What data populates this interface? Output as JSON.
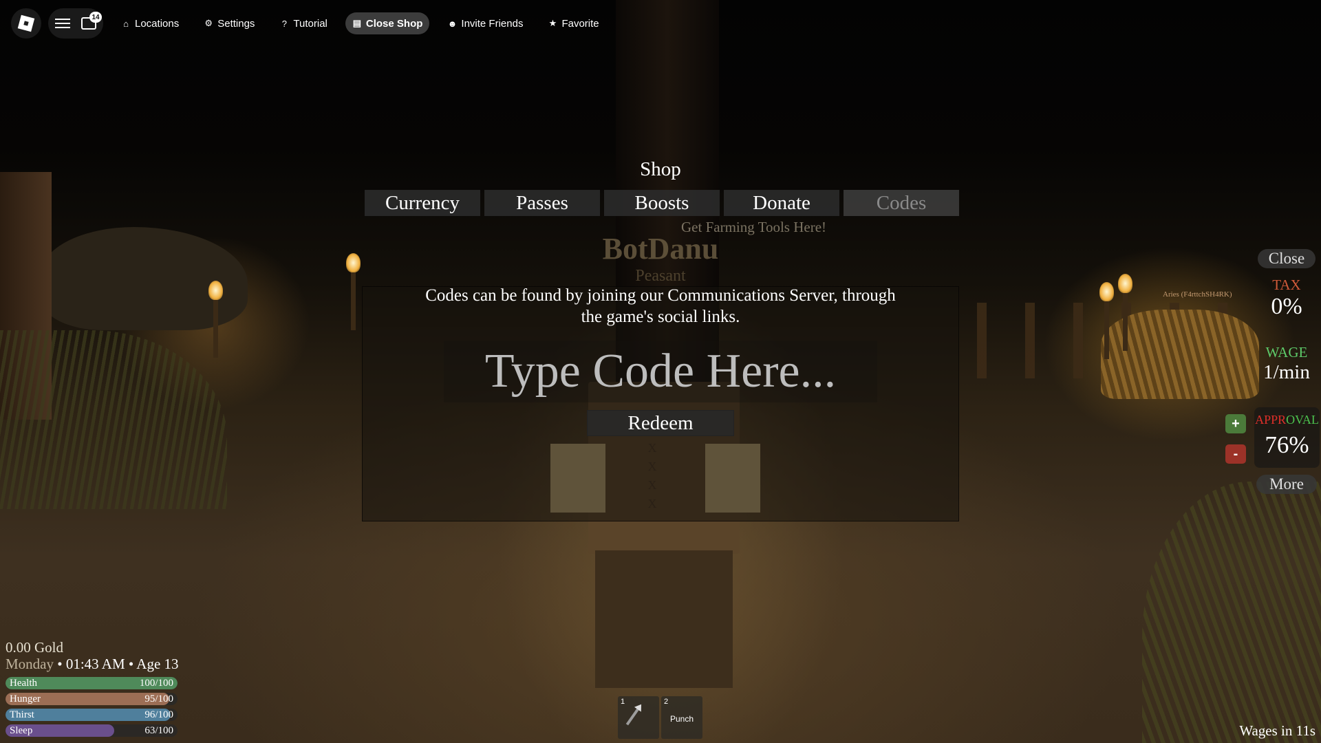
{
  "topbar": {
    "notification_count": "14",
    "items": [
      {
        "label": "Locations",
        "icon": "pin-icon"
      },
      {
        "label": "Settings",
        "icon": "gear-icon"
      },
      {
        "label": "Tutorial",
        "icon": "question-icon"
      },
      {
        "label": "Close Shop",
        "icon": "shop-icon"
      },
      {
        "label": "Invite Friends",
        "icon": "friends-icon"
      },
      {
        "label": "Favorite",
        "icon": "star-icon"
      }
    ]
  },
  "shop": {
    "title": "Shop",
    "tabs": [
      "Currency",
      "Passes",
      "Boosts",
      "Donate",
      "Codes"
    ],
    "active_tab": "Codes",
    "info": "Codes can be found by joining our Communications Server,  through the game's social links.",
    "code_placeholder": "Type Code Here...",
    "redeem_label": "Redeem"
  },
  "scene": {
    "farm_tip": "Get Farming Tools Here!",
    "npc_name": "BotDanu",
    "npc_role": "Peasant",
    "player_tag": "Aries (F4rttchSH4RK)",
    "x_marks": [
      "X",
      "X",
      "X",
      "X"
    ]
  },
  "right_hud": {
    "close_label": "Close",
    "tax_label": "TAX",
    "tax_value": "0%",
    "wage_label": "WAGE",
    "wage_value": "1/min",
    "approval_label_part1": "APPR",
    "approval_label_part2": "OVAL",
    "approval_value": "76%",
    "plus_label": "+",
    "minus_label": "-",
    "more_label": "More"
  },
  "status": {
    "gold": "0.00 Gold",
    "day": "Monday",
    "time_age": " • 01:43 AM • Age 13",
    "bars": [
      {
        "name": "Health",
        "value": "100/100",
        "fraction": 1.0,
        "color": "#4f8a5a"
      },
      {
        "name": "Hunger",
        "value": "95/100",
        "fraction": 0.95,
        "color": "#9c6e55"
      },
      {
        "name": "Thirst",
        "value": "96/100",
        "fraction": 0.96,
        "color": "#4f7f9c"
      },
      {
        "name": "Sleep",
        "value": "63/100",
        "fraction": 0.63,
        "color": "#6a4f8c"
      }
    ]
  },
  "hotbar": [
    {
      "slot": "1",
      "label": "",
      "icon": "spear-icon"
    },
    {
      "slot": "2",
      "label": "Punch",
      "icon": ""
    }
  ],
  "wages_timer": "Wages in 11s"
}
